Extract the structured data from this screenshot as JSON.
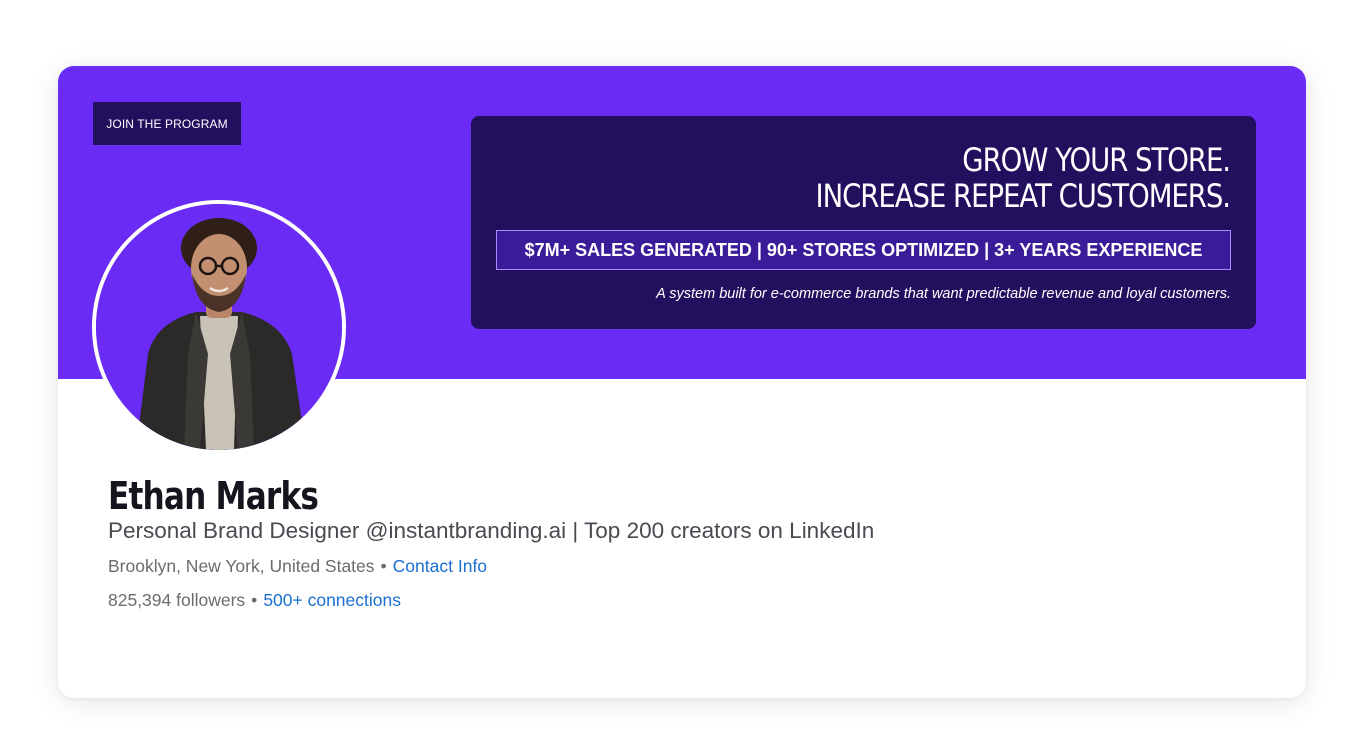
{
  "banner": {
    "join_button": "JOIN THE PROGRAM",
    "headline_line1": "GROW YOUR STORE.",
    "headline_line2": "INCREASE REPEAT CUSTOMERS.",
    "stats": "$7M+ SALES GENERATED | 90+ STORES OPTIMIZED | 3+ YEARS EXPERIENCE",
    "tagline": "A system built for e-commerce brands that want predictable revenue and loyal customers."
  },
  "profile": {
    "name": "Ethan Marks",
    "headline": "Personal Brand Designer @instantbranding.ai | Top 200 creators on LinkedIn",
    "location": "Brooklyn, New York, United States",
    "separator": "•",
    "contact_info": "Contact Info",
    "followers": "825,394 followers",
    "connections": "500+ connections"
  },
  "colors": {
    "banner": "#6a2cf5",
    "promo_box": "#22105f",
    "link": "#1a6fd1"
  }
}
